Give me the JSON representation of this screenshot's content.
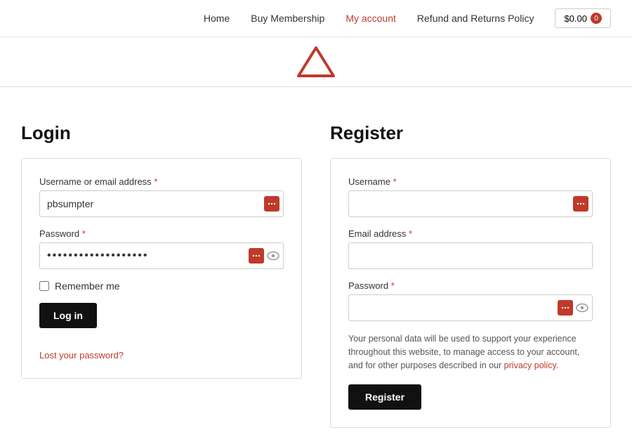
{
  "header": {
    "nav": [
      {
        "label": "Home",
        "active": false
      },
      {
        "label": "Buy Membership",
        "active": false
      },
      {
        "label": "My account",
        "active": true
      },
      {
        "label": "Refund and Returns Policy",
        "active": false
      }
    ],
    "cart_amount": "$0.00",
    "cart_count": "0"
  },
  "login": {
    "title": "Login",
    "username_label": "Username or email address",
    "username_value": "pbsumpter",
    "username_placeholder": "",
    "password_label": "Password",
    "password_value": "••••••••••••••••",
    "remember_label": "Remember me",
    "login_button": "Log in",
    "forgot_link": "Lost your password?"
  },
  "register": {
    "title": "Register",
    "username_label": "Username",
    "email_label": "Email address",
    "password_label": "Password",
    "privacy_text1": "Your personal data will be used to support your experience throughout this website, to manage access to your account, and for other purposes described in our ",
    "privacy_link_text": "privacy policy.",
    "register_button": "Register"
  }
}
